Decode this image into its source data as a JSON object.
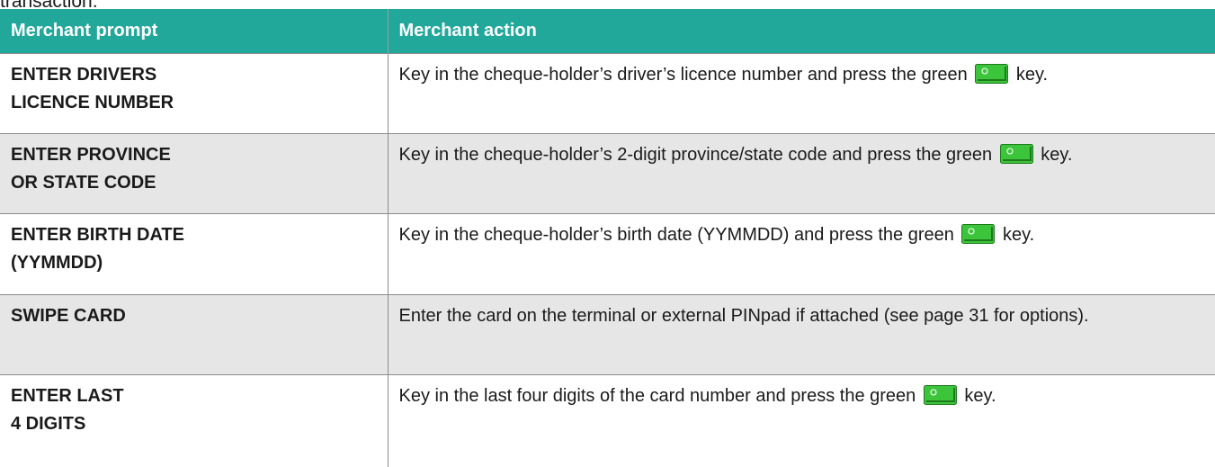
{
  "fragment_text": "transaction.",
  "header": {
    "col1": "Merchant prompt",
    "col2": "Merchant action"
  },
  "rows": [
    {
      "prompt_line1": "ENTER DRIVERS",
      "prompt_line2": "LICENCE NUMBER",
      "action_before": "Key in the cheque-holder’s driver’s licence number and press the green ",
      "action_after": " key."
    },
    {
      "prompt_line1": "ENTER PROVINCE",
      "prompt_line2": "OR STATE CODE",
      "action_before": "Key in the cheque-holder’s 2-digit province/state code and press the green ",
      "action_after": " key."
    },
    {
      "prompt_line1": "ENTER BIRTH DATE",
      "prompt_line2": "(YYMMDD)",
      "action_before": "Key in the cheque-holder’s birth date (YYMMDD) and press the green ",
      "action_after": " key."
    },
    {
      "prompt_line1": "SWIPE CARD",
      "prompt_line2": "",
      "action_before": "Enter the card on the terminal or external PINpad if attached (see page 31 for options).",
      "action_after": ""
    },
    {
      "prompt_line1": "ENTER LAST",
      "prompt_line2": "4 DIGITS",
      "action_before": "Key in the last four digits of the card number and press the green ",
      "action_after": " key."
    }
  ],
  "icons": {
    "green_key": "green-key-icon"
  },
  "colors": {
    "header_bg": "#21a89b",
    "header_text": "#ffffff",
    "shaded_row": "#e6e6e6",
    "key_green": "#3cc43a"
  }
}
